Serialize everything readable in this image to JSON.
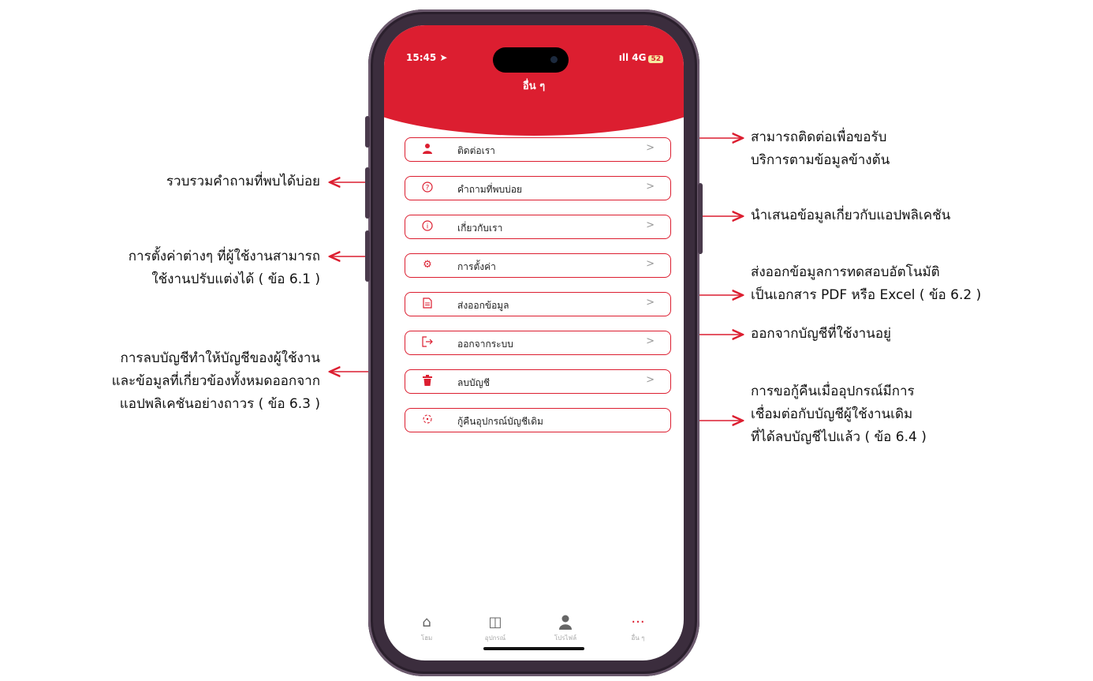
{
  "status_bar": {
    "time": "15:45 ➤",
    "signal": "ıll 4G",
    "battery": "52"
  },
  "header": {
    "title": "อื่น ๆ"
  },
  "menu": [
    {
      "label": "ติดต่อเรา",
      "icon": "person-icon"
    },
    {
      "label": "คำถามที่พบบ่อย",
      "icon": "question-icon"
    },
    {
      "label": "เกี่ยวกับเรา",
      "icon": "info-icon"
    },
    {
      "label": "การตั้งค่า",
      "icon": "gear-icon"
    },
    {
      "label": "ส่งออกข้อมูล",
      "icon": "document-icon"
    },
    {
      "label": "ออกจากระบบ",
      "icon": "logout-icon"
    },
    {
      "label": "ลบบัญชี",
      "icon": "trash-icon"
    },
    {
      "label": "กู้คืนอุปกรณ์บัญชีเดิม",
      "icon": "restore-icon"
    }
  ],
  "tabbar": [
    {
      "label": "โฮม",
      "icon": "home-icon"
    },
    {
      "label": "อุปกรณ์",
      "icon": "devices-icon"
    },
    {
      "label": "โปรไฟล์",
      "icon": "profile-icon"
    },
    {
      "label": "อื่น ๆ",
      "icon": "more-icon"
    }
  ],
  "annotations": {
    "contact": [
      "สามารถติดต่อเพื่อขอรับ",
      "บริการตามข้อมูลข้างต้น"
    ],
    "faq": [
      "รวบรวมคำถามที่พบได้บ่อย"
    ],
    "about": [
      "นำเสนอข้อมูลเกี่ยวกับแอปพลิเคชัน"
    ],
    "settings": [
      "การตั้งค่าต่างๆ ที่ผู้ใช้งานสามารถ",
      "ใช้งานปรับแต่งได้ ( ข้อ 6.1 )"
    ],
    "export": [
      "ส่งออกข้อมูลการทดสอบอัตโนมัติ",
      "เป็นเอกสาร PDF หรือ Excel ( ข้อ 6.2 )"
    ],
    "logout": [
      "ออกจากบัญชีที่ใช้งานอยู่"
    ],
    "delete": [
      "การลบบัญชีทำให้บัญชีของผู้ใช้งาน",
      "และข้อมูลที่เกี่ยวข้องทั้งหมดออกจาก",
      "แอปพลิเคชันอย่างถาวร ( ข้อ 6.3 )"
    ],
    "restore": [
      "การขอกู้คืนเมื่ออุปกรณ์มีการ",
      "เชื่อมต่อกับบัญชีผู้ใช้งานเดิม",
      "ที่ได้ลบบัญชีไปแล้ว ( ข้อ 6.4 )"
    ]
  },
  "colors": {
    "accent": "#dc1e30",
    "frame": "#3b2d3d"
  }
}
